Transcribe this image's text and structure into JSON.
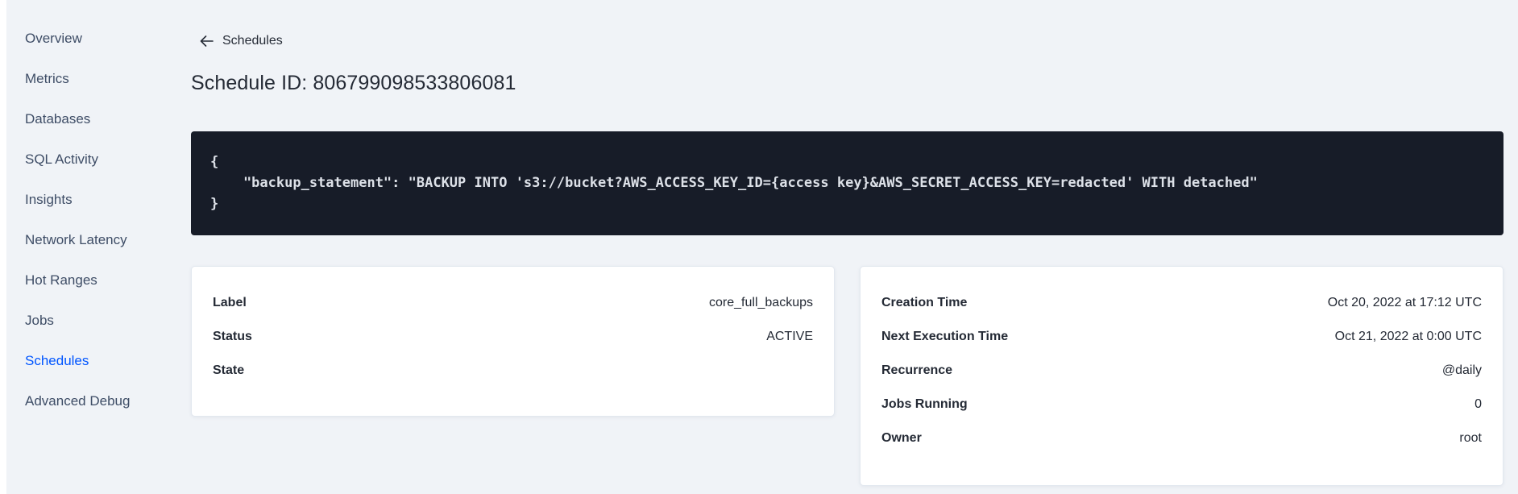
{
  "sidebar": {
    "items": [
      {
        "label": "Overview",
        "active": false
      },
      {
        "label": "Metrics",
        "active": false
      },
      {
        "label": "Databases",
        "active": false
      },
      {
        "label": "SQL Activity",
        "active": false
      },
      {
        "label": "Insights",
        "active": false
      },
      {
        "label": "Network Latency",
        "active": false
      },
      {
        "label": "Hot Ranges",
        "active": false
      },
      {
        "label": "Jobs",
        "active": false
      },
      {
        "label": "Schedules",
        "active": true
      },
      {
        "label": "Advanced Debug",
        "active": false
      }
    ]
  },
  "header": {
    "back_label": "Schedules",
    "title": "Schedule ID: 806799098533806081"
  },
  "code_block": {
    "lines": [
      "{",
      "    \"backup_statement\": \"BACKUP INTO 's3://bucket?AWS_ACCESS_KEY_ID={access key}&AWS_SECRET_ACCESS_KEY=redacted' WITH detached\"",
      "}"
    ]
  },
  "cards": {
    "left": {
      "rows": [
        {
          "label": "Label",
          "value": "core_full_backups"
        },
        {
          "label": "Status",
          "value": "ACTIVE"
        },
        {
          "label": "State",
          "value": ""
        }
      ]
    },
    "right": {
      "rows": [
        {
          "label": "Creation Time",
          "value": "Oct 20, 2022 at 17:12 UTC"
        },
        {
          "label": "Next Execution Time",
          "value": "Oct 21, 2022 at 0:00 UTC"
        },
        {
          "label": "Recurrence",
          "value": "@daily"
        },
        {
          "label": "Jobs Running",
          "value": "0"
        },
        {
          "label": "Owner",
          "value": "root"
        }
      ]
    }
  },
  "colors": {
    "accent_blue": "#0055ff",
    "page_bg": "#f0f3f7",
    "code_bg": "#171c28",
    "text_dark": "#242a35",
    "sidebar_text": "#3e4d66"
  }
}
